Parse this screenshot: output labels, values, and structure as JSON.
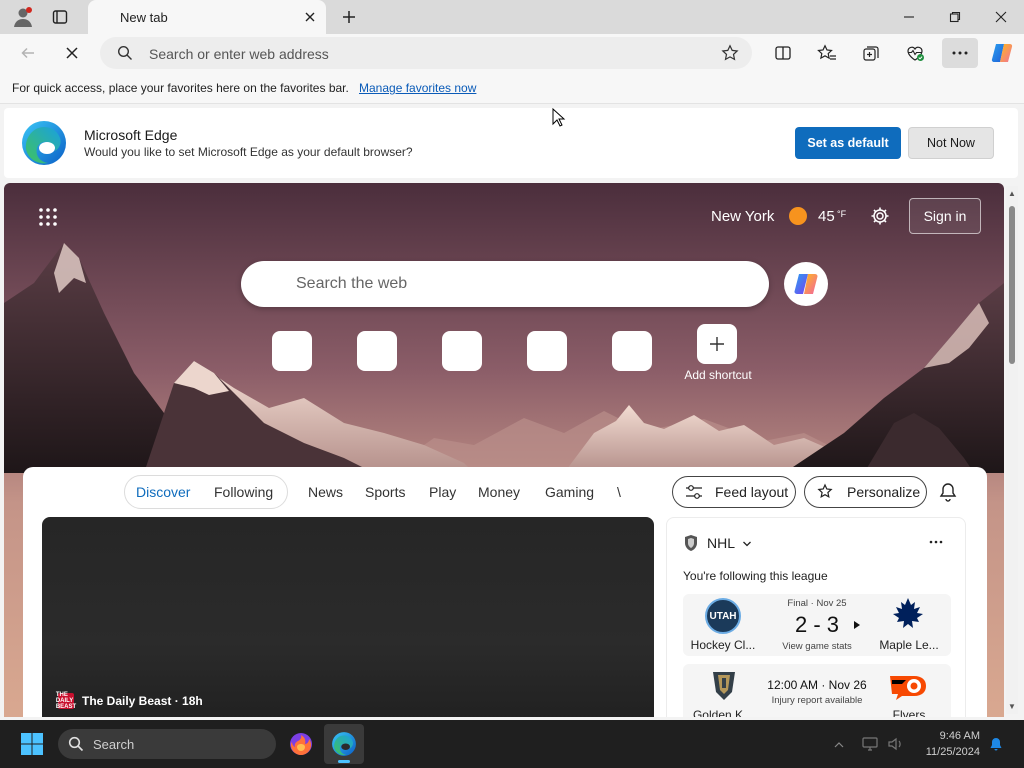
{
  "browser": {
    "tab_title": "New tab",
    "address_placeholder": "Search or enter web address",
    "favorites_bar_text": "For quick access, place your favorites here on the favorites bar.",
    "favorites_bar_link": "Manage favorites now"
  },
  "default_prompt": {
    "title": "Microsoft Edge",
    "subtitle": "Would you like to set Microsoft Edge as your default browser?",
    "primary_button": "Set as default",
    "secondary_button": "Not Now"
  },
  "ntp": {
    "weather_city": "New York",
    "weather_temp": "45",
    "weather_unit": "°F",
    "sign_in": "Sign in",
    "search_placeholder": "Search the web",
    "add_shortcut": "Add shortcut"
  },
  "feed": {
    "segments": [
      "Discover",
      "Following"
    ],
    "nav": [
      "News",
      "Sports",
      "Play",
      "Money",
      "Gaming",
      "\\"
    ],
    "feed_layout": "Feed layout",
    "personalize": "Personalize",
    "hero_source": "The Daily Beast",
    "hero_time": "18h",
    "hero_source_icon_text": "THE DAILY BEAST"
  },
  "sports": {
    "league": "NHL",
    "following": "You're following this league",
    "game1": {
      "status": "Final · Nov 25",
      "score": "2 - 3",
      "link": "View game stats",
      "home": "Hockey Cl...",
      "away": "Maple Le...",
      "home_logo_text": "UTAH"
    },
    "game2": {
      "time": "12:00 AM · Nov 26",
      "link": "Injury report available",
      "home": "Golden K...",
      "away": "Flyers"
    }
  },
  "taskbar": {
    "search_label": "Search",
    "clock_time": "9:46 AM",
    "clock_date": "11/25/2024"
  },
  "colors": {
    "accent": "#0f6cbd",
    "sun": "#f7931e"
  }
}
